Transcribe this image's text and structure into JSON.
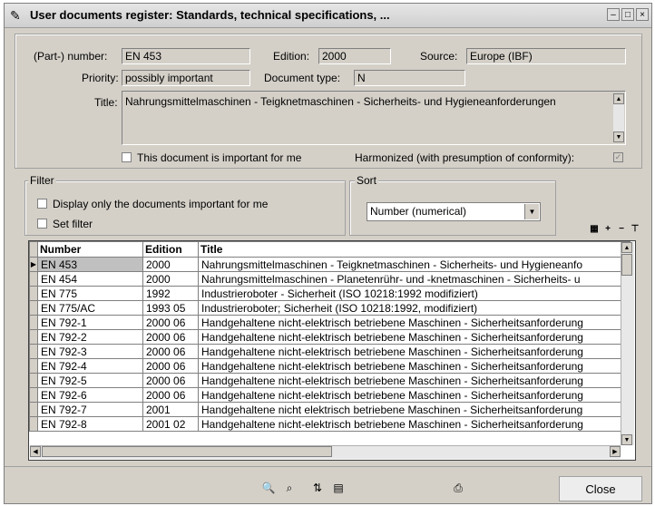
{
  "window": {
    "title": "User documents register: Standards, technical specifications, ...",
    "icon": "document-register-icon"
  },
  "doc": {
    "part_number_label": "(Part-) number:",
    "part_number": "EN 453",
    "edition_label": "Edition:",
    "edition": "2000",
    "source_label": "Source:",
    "source": "Europe (IBF)",
    "priority_label": "Priority:",
    "priority": "possibly important",
    "doctype_label": "Document type:",
    "doctype": "N",
    "title_label": "Title:",
    "title": "Nahrungsmittelmaschinen - Teigknetmaschinen - Sicherheits- und Hygieneanforderungen",
    "important_label": "This document is important for me",
    "harmonized_label": "Harmonized (with presumption of conformity):"
  },
  "filter": {
    "legend": "Filter",
    "only_important_label": "Display only the documents important for me",
    "set_filter_label": "Set filter"
  },
  "sort": {
    "legend": "Sort",
    "selected": "Number (numerical)"
  },
  "table": {
    "headers": [
      "Number",
      "Edition",
      "Title"
    ],
    "rows": [
      {
        "number": "EN 453",
        "edition": "2000",
        "title": "Nahrungsmittelmaschinen - Teigknetmaschinen - Sicherheits- und Hygieneanfo"
      },
      {
        "number": "EN 454",
        "edition": "2000",
        "title": "Nahrungsmittelmaschinen - Planetenrühr- und -knetmaschinen - Sicherheits- u"
      },
      {
        "number": "EN 775",
        "edition": "1992",
        "title": "Industrieroboter - Sicherheit (ISO 10218:1992 modifiziert)"
      },
      {
        "number": "EN 775/AC",
        "edition": "1993 05",
        "title": "Industrieroboter; Sicherheit (ISO 10218:1992, modifiziert)"
      },
      {
        "number": "EN 792-1",
        "edition": "2000 06",
        "title": "Handgehaltene nicht-elektrisch betriebene Maschinen - Sicherheitsanforderung"
      },
      {
        "number": "EN 792-2",
        "edition": "2000 06",
        "title": "Handgehaltene nicht-elektrisch betriebene Maschinen - Sicherheitsanforderung"
      },
      {
        "number": "EN 792-3",
        "edition": "2000 06",
        "title": "Handgehaltene nicht-elektrisch betriebene Maschinen - Sicherheitsanforderung"
      },
      {
        "number": "EN 792-4",
        "edition": "2000 06",
        "title": "Handgehaltene nicht-elektrisch betriebene Maschinen - Sicherheitsanforderung"
      },
      {
        "number": "EN 792-5",
        "edition": "2000 06",
        "title": "Handgehaltene nicht-elektrisch betriebene Maschinen - Sicherheitsanforderung"
      },
      {
        "number": "EN 792-6",
        "edition": "2000 06",
        "title": "Handgehaltene nicht-elektrisch betriebene Maschinen - Sicherheitsanforderung"
      },
      {
        "number": "EN 792-7",
        "edition": "2001",
        "title": "Handgehaltene nicht elektrisch betriebene Maschinen - Sicherheitsanforderung"
      },
      {
        "number": "EN 792-8",
        "edition": "2001 02",
        "title": "Handgehaltene nicht-elektrisch betriebene Maschinen - Sicherheitsanforderung"
      }
    ]
  },
  "buttons": {
    "close_label": "Close"
  }
}
